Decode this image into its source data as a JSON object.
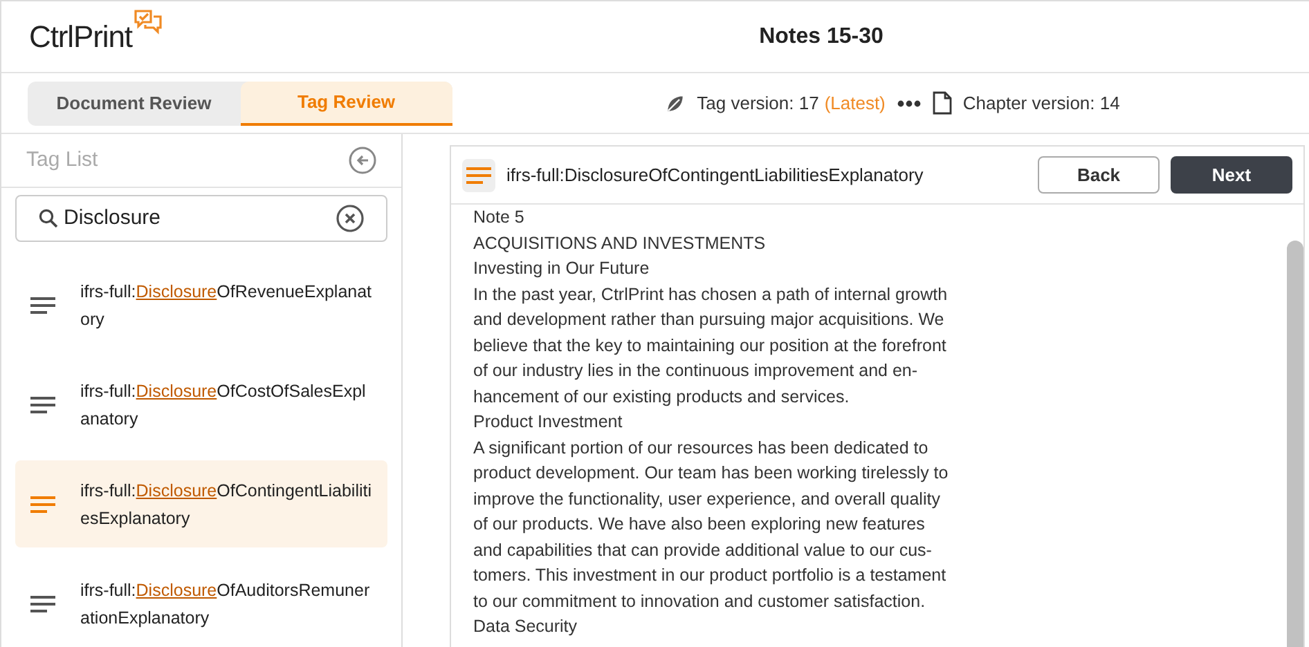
{
  "app": {
    "logo": "CtrlPrint",
    "title": "Notes 15-30"
  },
  "tabs": [
    {
      "label": "Document Review",
      "selected": false
    },
    {
      "label": "Tag Review",
      "selected": true
    }
  ],
  "versions": {
    "tag_label": "Tag version: 17",
    "tag_status": "(Latest)",
    "chapter_label": "Chapter version: 14"
  },
  "sidebar": {
    "title": "Tag List",
    "search": {
      "value": "Disclosure"
    },
    "items": [
      {
        "prefix": "ifrs-full:",
        "match": "Disclosure",
        "suffix": "OfRevenueExplanatory",
        "selected": false
      },
      {
        "prefix": "ifrs-full:",
        "match": "Disclosure",
        "suffix": "OfCostOfSalesExplanatory",
        "selected": false
      },
      {
        "prefix": "ifrs-full:",
        "match": "Disclosure",
        "suffix": "OfContingentLiabilitiesExplanatory",
        "selected": true
      },
      {
        "prefix": "ifrs-full:",
        "match": "Disclosure",
        "suffix": "OfAuditorsRemunerationExplanatory",
        "selected": false
      }
    ]
  },
  "document": {
    "tag": "ifrs-full:DisclosureOfContingentLiabilitiesExplanatory",
    "buttons": [
      {
        "label": "Back",
        "kind": "secondary"
      },
      {
        "label": "Next",
        "kind": "primary"
      }
    ],
    "lines": [
      "Note 5",
      "ACQUISITIONS AND INVESTMENTS",
      "Investing in Our Future",
      "In the past year, CtrlPrint has chosen a path of internal growth",
      "and development rather than pursuing major acquisitions. We",
      "believe that the key to maintaining our position at the forefront",
      "of our industry lies in the continuous improvement and en-",
      "hancement of our existing products and services.",
      "Product Investment",
      "A significant portion of our resources has been dedicated to",
      "product development. Our team has been working tirelessly to",
      "improve the functionality, user experience, and overall quality",
      "of our products. We have also been exploring new features",
      "and capabilities that can provide additional value to our cus-",
      "tomers. This investment in our product portfolio is a testament",
      "to our commitment to innovation and customer satisfaction.",
      "Data Security"
    ]
  }
}
